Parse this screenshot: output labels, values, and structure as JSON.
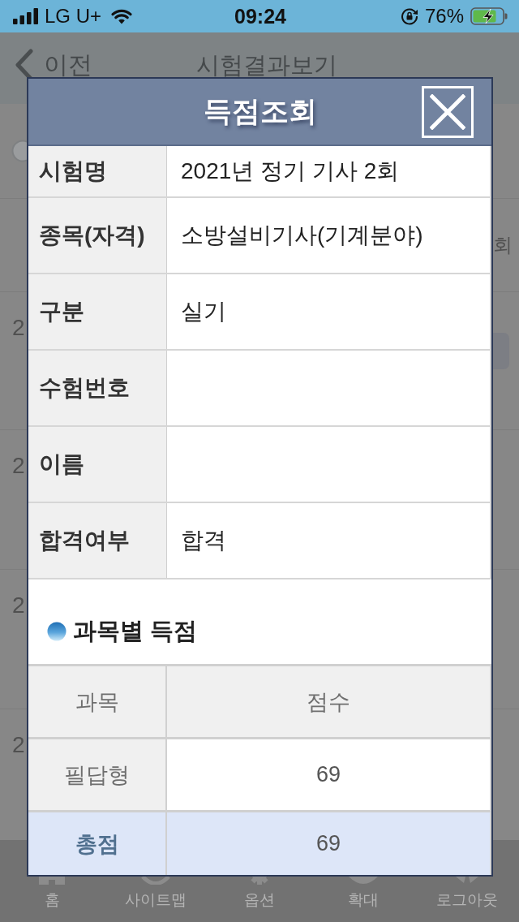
{
  "status_bar": {
    "carrier": "LG U+",
    "time": "09:24",
    "battery": "76%"
  },
  "page": {
    "back_label": "이전",
    "title": "시험결과보기",
    "column_header": "회",
    "rows": [
      {
        "text": "2",
        "has_button": true
      },
      {
        "text": "2",
        "has_button": false
      },
      {
        "text": "2",
        "has_button": false
      },
      {
        "text": "2",
        "has_button": false
      }
    ]
  },
  "dialog": {
    "title": "득점조회",
    "info_rows": [
      {
        "label": "시험명",
        "value": "2021년 정기 기사 2회"
      },
      {
        "label": "종목(자격)",
        "value": "소방설비기사(기계분야)"
      },
      {
        "label": "구분",
        "value": "실기"
      },
      {
        "label": "수험번호"
      },
      {
        "label": "이름"
      },
      {
        "label": "합격여부",
        "value": "합격"
      }
    ],
    "score_section": {
      "heading": "과목별 득점",
      "columns": [
        "과목",
        "점수"
      ],
      "rows": [
        {
          "kind": "subject",
          "subject": "필답형",
          "score": "69"
        },
        {
          "kind": "total",
          "subject": "총점",
          "score": "69"
        }
      ]
    }
  },
  "tab_bar": [
    {
      "label": "홈"
    },
    {
      "label": "사이트맵"
    },
    {
      "label": "옵션"
    },
    {
      "label": "확대"
    },
    {
      "label": "로그아웃"
    }
  ]
}
